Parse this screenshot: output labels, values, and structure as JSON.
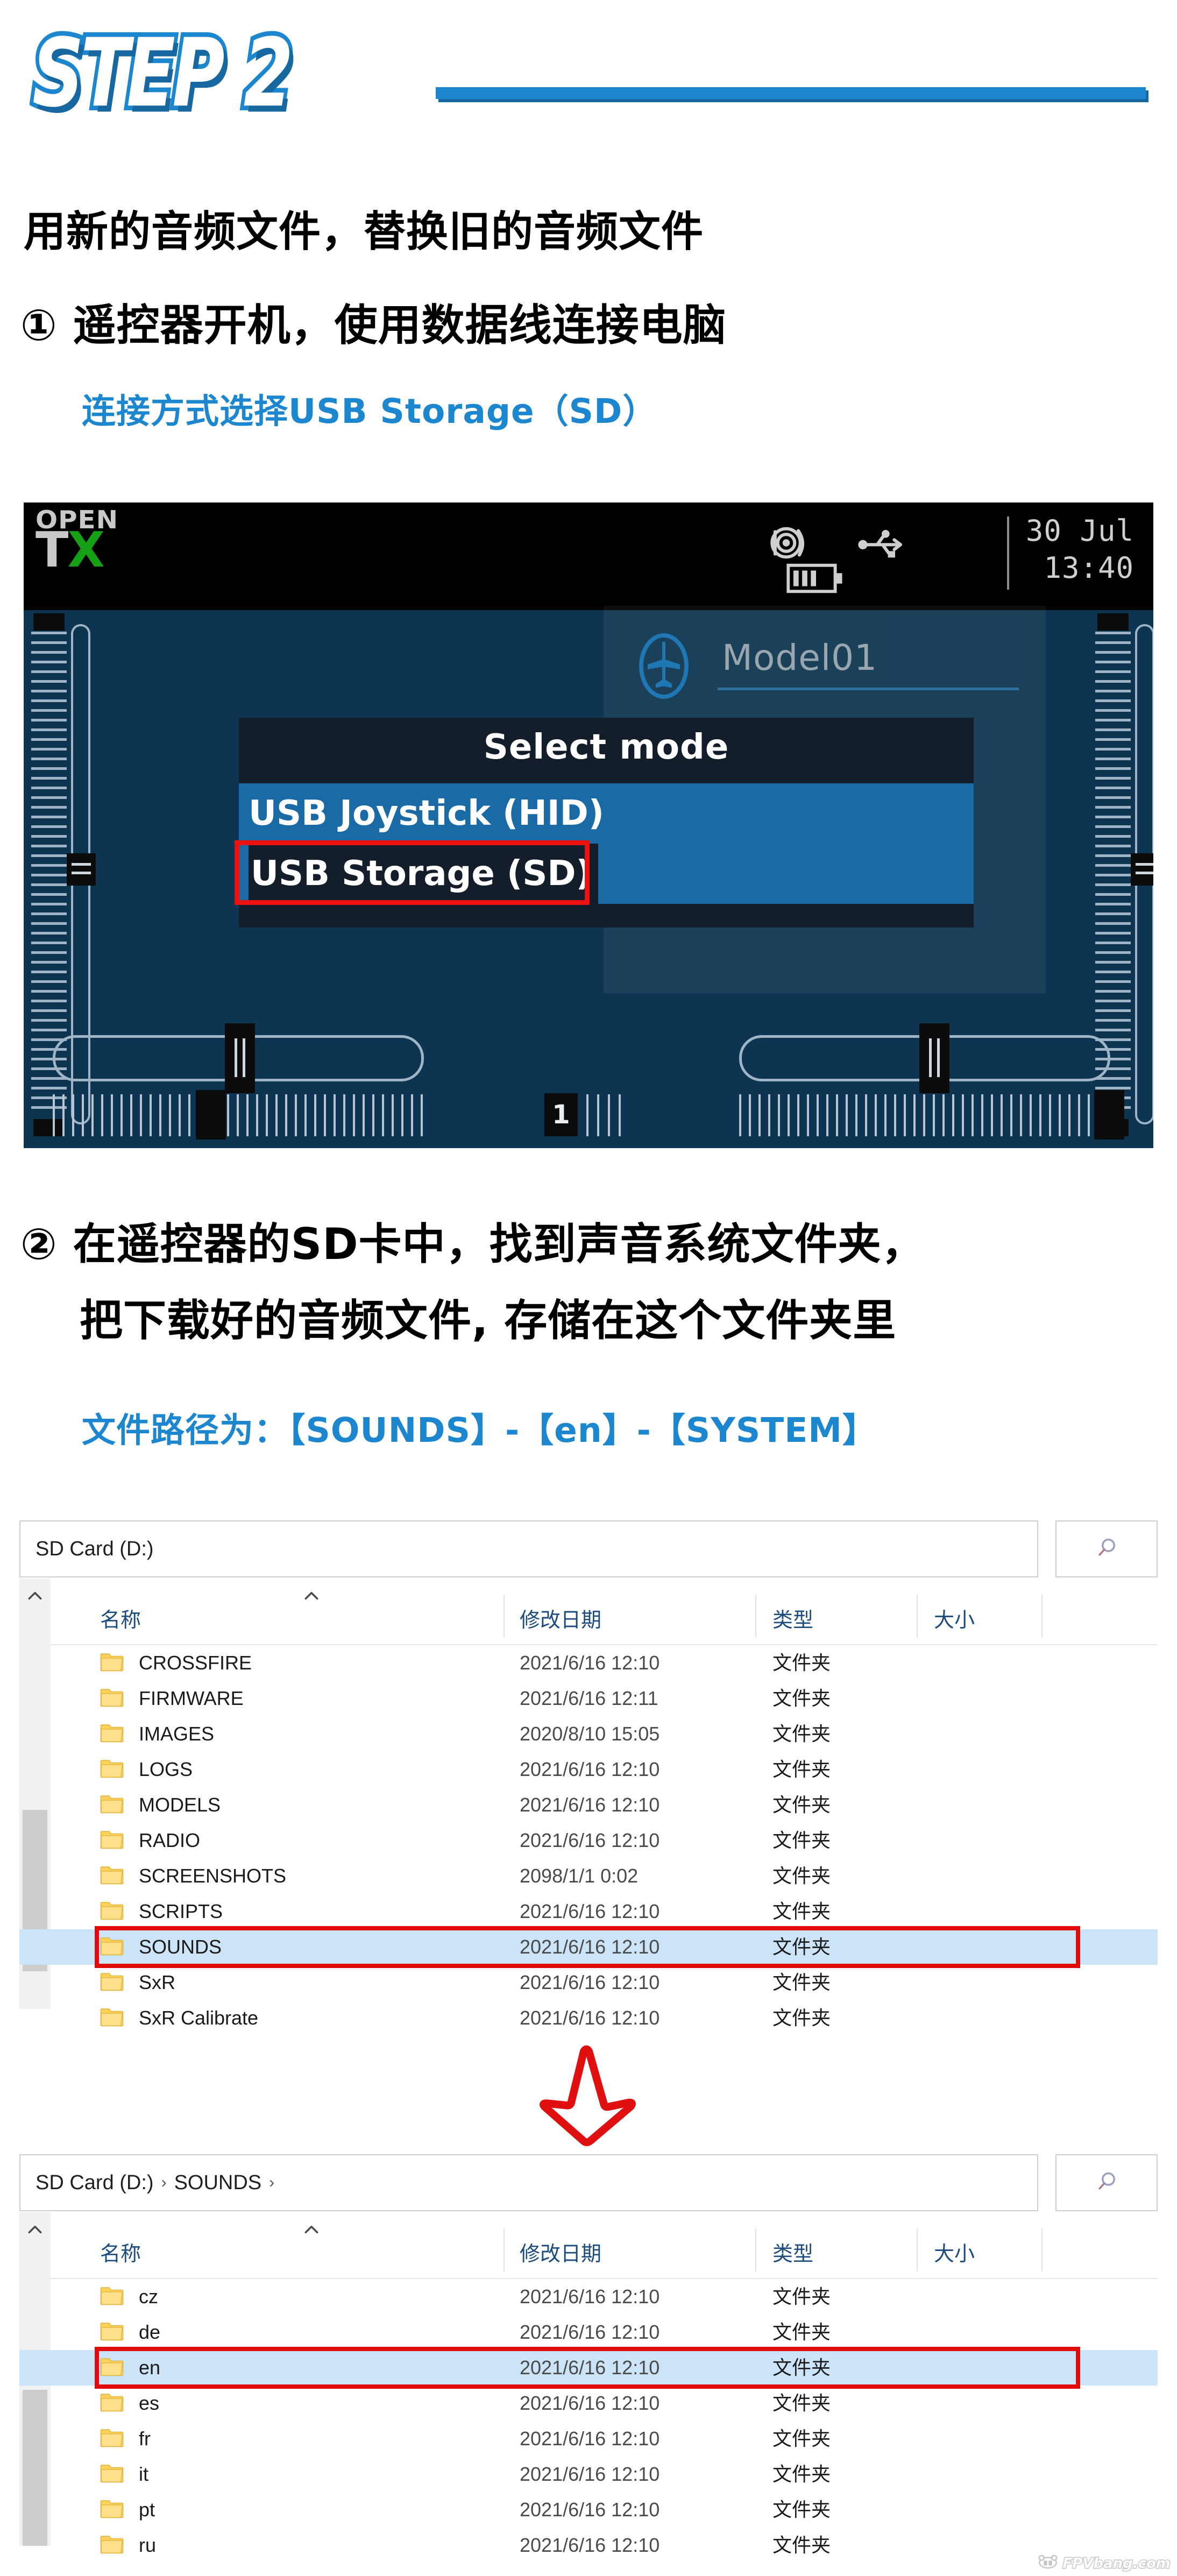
{
  "header": {
    "step_label": "STEP 2"
  },
  "intro": {
    "title": "用新的音频文件，替换旧的音频文件",
    "step1": "① 遥控器开机，使用数据线连接电脑",
    "step1_note": "连接方式选择USB Storage（SD）",
    "step2_line1": "② 在遥控器的SD卡中，找到声音系统文件夹，",
    "step2_line2": "把下载好的音频文件, 存储在这个文件夹里",
    "step2_note": "文件路径为：【SOUNDS】-【en】-【SYSTEM】"
  },
  "radio": {
    "logo_open": "OPEN",
    "logo_t": "T",
    "logo_x": "X",
    "status": {
      "speaker_icon": "speaker-icon",
      "usb_icon": "usb-icon",
      "battery_icon": "battery-icon",
      "date": "30 Jul",
      "time": "13:40"
    },
    "model": {
      "plane_icon": "airplane-icon",
      "name": "Model01"
    },
    "dialog": {
      "title": "Select mode",
      "options": [
        {
          "label": "USB Joystick (HID)",
          "highlighted": false
        },
        {
          "label": "USB Storage (SD)",
          "highlighted": true
        }
      ]
    },
    "bottom_channel": "1"
  },
  "explorer1": {
    "breadcrumb": [
      "SD Card (D:)"
    ],
    "caret_icon": "chevron-down-icon",
    "refresh_icon": "refresh-icon",
    "search_icon": "search-icon",
    "columns": [
      "名称",
      "修改日期",
      "类型",
      "大小"
    ],
    "rows": [
      {
        "name": "CROSSFIRE",
        "date": "2021/6/16 12:10",
        "type": "文件夹",
        "size": "",
        "selected": false
      },
      {
        "name": "FIRMWARE",
        "date": "2021/6/16 12:11",
        "type": "文件夹",
        "size": "",
        "selected": false
      },
      {
        "name": "IMAGES",
        "date": "2020/8/10 15:05",
        "type": "文件夹",
        "size": "",
        "selected": false
      },
      {
        "name": "LOGS",
        "date": "2021/6/16 12:10",
        "type": "文件夹",
        "size": "",
        "selected": false
      },
      {
        "name": "MODELS",
        "date": "2021/6/16 12:10",
        "type": "文件夹",
        "size": "",
        "selected": false
      },
      {
        "name": "RADIO",
        "date": "2021/6/16 12:10",
        "type": "文件夹",
        "size": "",
        "selected": false
      },
      {
        "name": "SCREENSHOTS",
        "date": "2098/1/1 0:02",
        "type": "文件夹",
        "size": "",
        "selected": false
      },
      {
        "name": "SCRIPTS",
        "date": "2021/6/16 12:10",
        "type": "文件夹",
        "size": "",
        "selected": false
      },
      {
        "name": "SOUNDS",
        "date": "2021/6/16 12:10",
        "type": "文件夹",
        "size": "",
        "selected": true
      },
      {
        "name": "SxR",
        "date": "2021/6/16 12:10",
        "type": "文件夹",
        "size": "",
        "selected": false
      },
      {
        "name": "SxR Calibrate",
        "date": "2021/6/16 12:10",
        "type": "文件夹",
        "size": "",
        "selected": false
      }
    ]
  },
  "explorer2": {
    "breadcrumb": [
      "SD Card (D:)",
      "SOUNDS"
    ],
    "caret_icon": "chevron-down-icon",
    "refresh_icon": "refresh-icon",
    "search_icon": "search-icon",
    "columns": [
      "名称",
      "修改日期",
      "类型",
      "大小"
    ],
    "rows": [
      {
        "name": "cz",
        "date": "2021/6/16 12:10",
        "type": "文件夹",
        "size": "",
        "selected": false
      },
      {
        "name": "de",
        "date": "2021/6/16 12:10",
        "type": "文件夹",
        "size": "",
        "selected": false
      },
      {
        "name": "en",
        "date": "2021/6/16 12:10",
        "type": "文件夹",
        "size": "",
        "selected": true
      },
      {
        "name": "es",
        "date": "2021/6/16 12:10",
        "type": "文件夹",
        "size": "",
        "selected": false
      },
      {
        "name": "fr",
        "date": "2021/6/16 12:10",
        "type": "文件夹",
        "size": "",
        "selected": false
      },
      {
        "name": "it",
        "date": "2021/6/16 12:10",
        "type": "文件夹",
        "size": "",
        "selected": false
      },
      {
        "name": "pt",
        "date": "2021/6/16 12:10",
        "type": "文件夹",
        "size": "",
        "selected": false
      },
      {
        "name": "ru",
        "date": "2021/6/16 12:10",
        "type": "文件夹",
        "size": "",
        "selected": false
      }
    ]
  },
  "arrow": {
    "icon": "down-arrow-icon"
  },
  "watermark": {
    "text": "FPVbang.com"
  },
  "colors": {
    "accent_blue": "#1c87ce",
    "accent_blue_shadow": "#1767a0",
    "highlight_red": "#e10b0b",
    "radio_bg": "#0d3551",
    "dialog_option_bg": "#1a6ba5",
    "row_selected": "#cce4f7",
    "opentx_green": "#16a016"
  }
}
